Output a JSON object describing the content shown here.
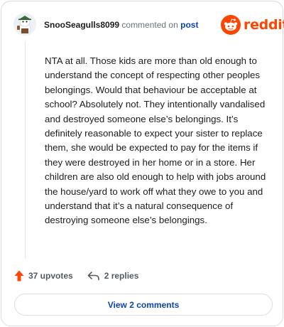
{
  "header": {
    "username": "SnooSeagulls8099",
    "commented_on": "commented on",
    "post_link": "post",
    "brand": "reddit",
    "brand_color": "#ff4500"
  },
  "comment": {
    "text": "NTA at all. Those kids are more than old enough to understand the concept of respecting other peoples belongings. Would that behaviour be acceptable at school? Absolutely not. They intentionally vandalised and destroyed someone else’s belongings. It’s definitely reasonable to expect your sister to replace them, she would be expected to pay for the items if they were destroyed in her home or in a store. Her children are also old enough to help with jobs around the house/yard to work off what they owe to you and understand that it’s a natural consequence of destroying someone else’s belongings."
  },
  "actions": {
    "upvotes": "37 upvotes",
    "replies": "2 replies",
    "upvote_icon": "upvote-arrow-icon",
    "reply_icon": "reply-arrow-icon",
    "upvote_color": "#ff4500"
  },
  "view_comments": "View 2 comments",
  "link_color": "#0a44b5"
}
